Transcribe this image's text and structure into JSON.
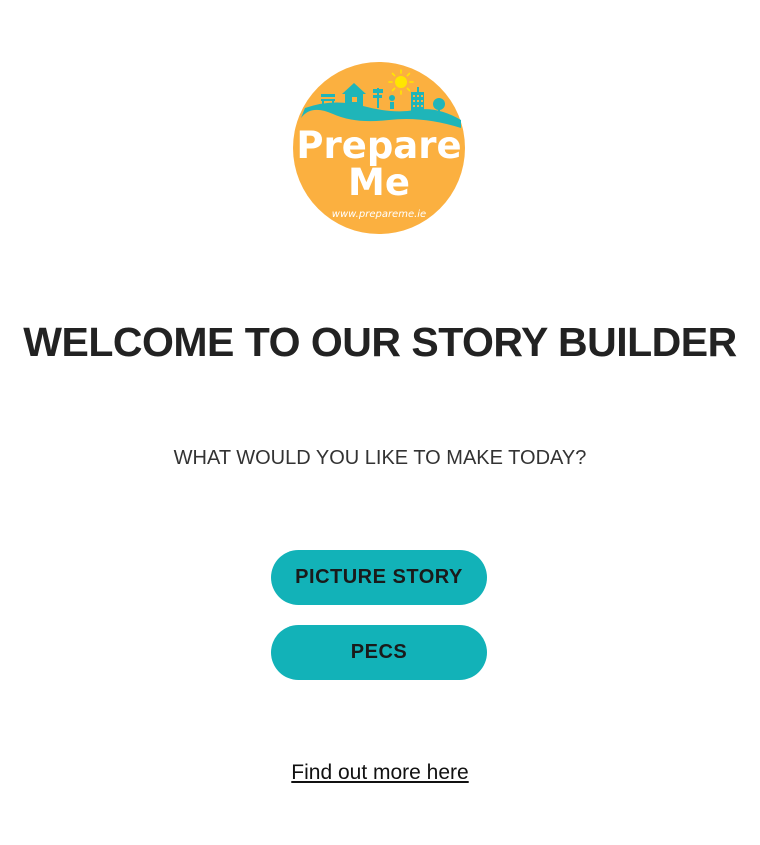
{
  "logo": {
    "line1": "Prepare",
    "line2": "Me",
    "url": "www.prepareme.ie",
    "colors": {
      "circle": "#fbb040",
      "teal": "#1fb5b9",
      "sun": "#ffe600"
    }
  },
  "heading": "WELCOME TO OUR STORY BUILDER",
  "subheading": "WHAT WOULD YOU LIKE TO MAKE TODAY?",
  "buttons": {
    "picture_story": "PICTURE STORY",
    "pecs": "PECS"
  },
  "footer_link": "Find out more here",
  "colors": {
    "button_bg": "#12b2b8",
    "text": "#222222",
    "background": "#ffffff"
  }
}
